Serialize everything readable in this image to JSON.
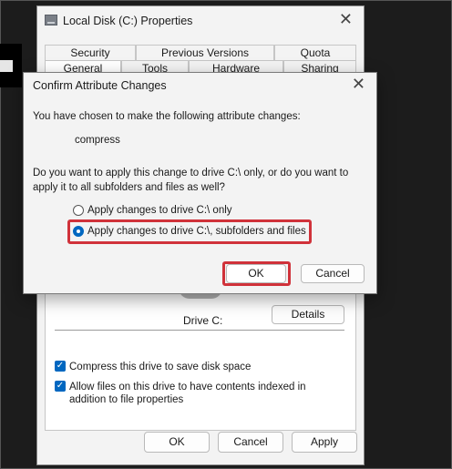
{
  "properties_window": {
    "title": "Local Disk (C:) Properties",
    "tabs_row1": [
      "Security",
      "Previous Versions",
      "Quota"
    ],
    "tabs_row2": [
      "General",
      "Tools",
      "Hardware",
      "Sharing"
    ],
    "active_tab": "General",
    "drive_label": "Drive C:",
    "details_label": "Details",
    "compress_label": "Compress this drive to save disk space",
    "compress_checked": true,
    "index_label": "Allow files on this drive to have contents indexed in addition to file properties",
    "index_checked": true,
    "buttons": {
      "ok": "OK",
      "cancel": "Cancel",
      "apply": "Apply"
    }
  },
  "dialog": {
    "title": "Confirm Attribute Changes",
    "intro": "You have chosen to make the following attribute changes:",
    "attribute": "compress",
    "question": "Do you want to apply this change to drive C:\\ only, or do you want to apply it to all subfolders and files as well?",
    "options": [
      {
        "label": "Apply changes to drive C:\\ only",
        "selected": false
      },
      {
        "label": "Apply changes to drive C:\\, subfolders and files",
        "selected": true
      }
    ],
    "ok_label": "OK",
    "cancel_label": "Cancel"
  },
  "colors": {
    "accent": "#0067c0",
    "highlight": "#d0323a",
    "background": "#1c1c1c"
  }
}
